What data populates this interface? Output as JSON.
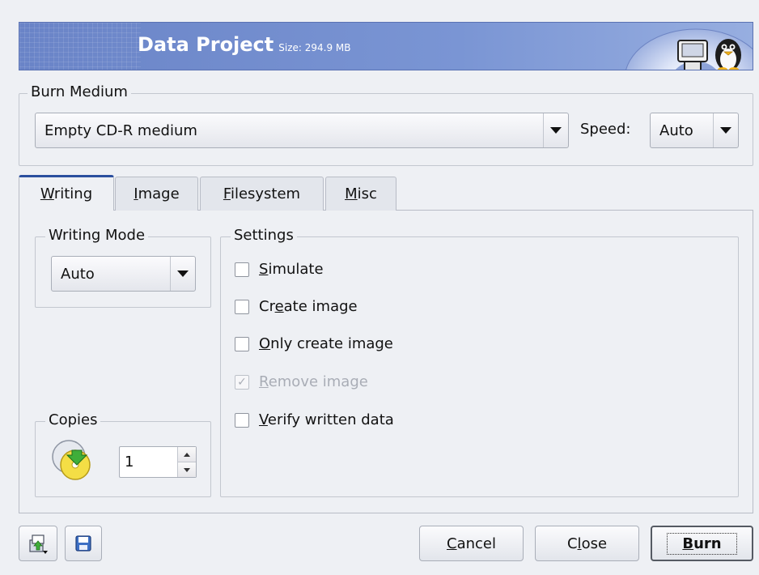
{
  "header": {
    "title": "Data Project",
    "size_label": "Size: 294.9 MB"
  },
  "burn_medium": {
    "group_title": "Burn Medium",
    "medium_value": "Empty CD-R medium",
    "speed_label": "Speed:",
    "speed_value": "Auto"
  },
  "tabs": [
    {
      "mnemonic": "W",
      "rest": "riting",
      "active": true
    },
    {
      "mnemonic": "I",
      "rest": "mage",
      "active": false
    },
    {
      "mnemonic": "F",
      "rest": "ilesystem",
      "active": false
    },
    {
      "mnemonic": "M",
      "rest": "isc",
      "active": false
    }
  ],
  "writing_mode": {
    "group_title": "Writing Mode",
    "value": "Auto"
  },
  "copies": {
    "group_title": "Copies",
    "value": "1"
  },
  "settings": {
    "group_title": "Settings",
    "options": [
      {
        "pre": "",
        "mnemonic": "S",
        "post": "imulate",
        "checked": false,
        "enabled": true
      },
      {
        "pre": "Cr",
        "mnemonic": "e",
        "post": "ate image",
        "checked": false,
        "enabled": true
      },
      {
        "pre": "",
        "mnemonic": "O",
        "post": "nly create image",
        "checked": false,
        "enabled": true
      },
      {
        "pre": "",
        "mnemonic": "R",
        "post": "emove image",
        "checked": true,
        "enabled": false
      },
      {
        "pre": "",
        "mnemonic": "V",
        "post": "erify written data",
        "checked": false,
        "enabled": true
      }
    ]
  },
  "footer": {
    "cancel": {
      "mnemonic": "C",
      "rest": "ancel"
    },
    "close": {
      "pre": "C",
      "mnemonic": "l",
      "rest": "ose"
    },
    "burn": {
      "mnemonic": "B",
      "rest": "urn"
    }
  },
  "colors": {
    "banner": "#6b86c9",
    "tab_accent": "#2b4f9e"
  },
  "icons": [
    "load-settings-icon",
    "save-settings-icon",
    "cd-copies-icon",
    "penguin-disc-art"
  ]
}
